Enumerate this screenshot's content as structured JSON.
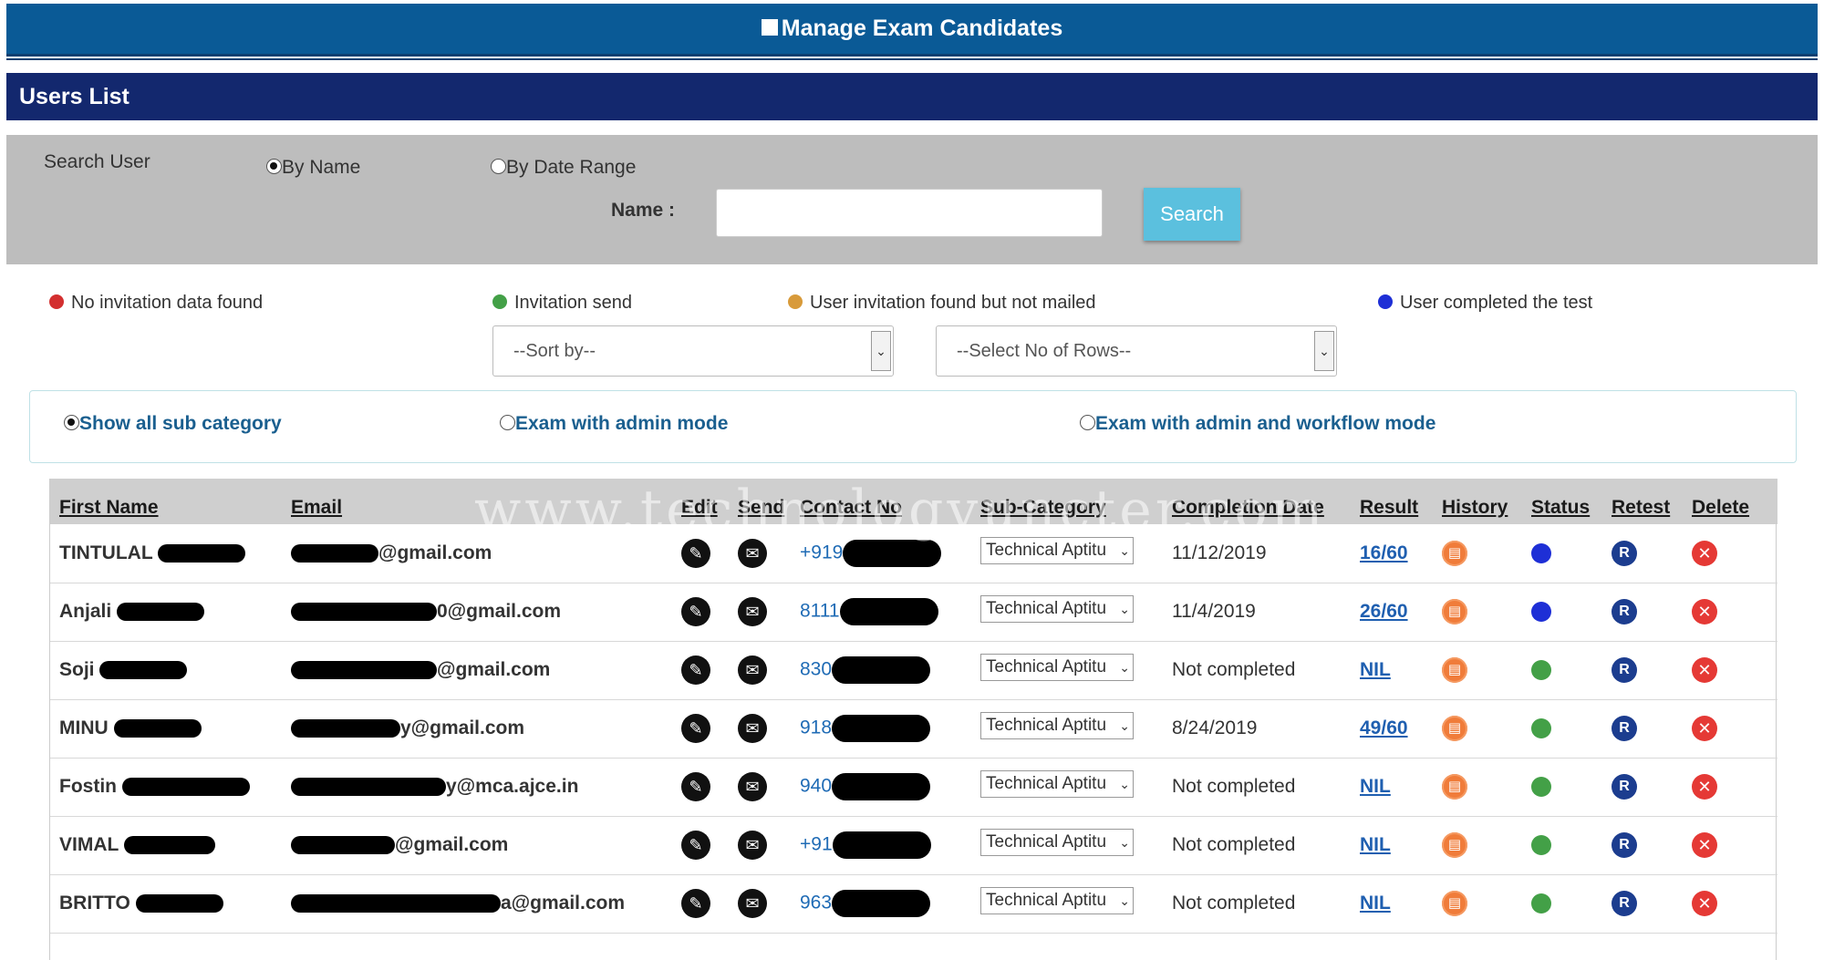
{
  "header": {
    "title": "Manage Exam Candidates"
  },
  "section": {
    "title": "Users List"
  },
  "search": {
    "label": "Search User",
    "by_name": "By Name",
    "by_date_range": "By Date Range",
    "name_label": "Name :",
    "name_value": "",
    "button": "Search"
  },
  "legend": {
    "items": [
      {
        "label": "No invitation data found",
        "color": "#d32f2f"
      },
      {
        "label": "Invitation send",
        "color": "#43a047"
      },
      {
        "label": "User invitation found but not mailed",
        "color": "#d89a3a"
      },
      {
        "label": "User completed the test",
        "color": "#1e2fd6"
      }
    ]
  },
  "filters": {
    "sort_by": "--Sort by--",
    "rows": "--Select No of Rows--"
  },
  "subcategory_options": {
    "show_all": "Show all sub category",
    "admin_mode": "Exam with admin mode",
    "admin_workflow": "Exam with admin and workflow mode"
  },
  "table": {
    "headers": {
      "first_name": "First Name",
      "email": "Email",
      "edit": "Edit",
      "send": "Send",
      "contact": "Contact No",
      "subcategory": "Sub-Category",
      "completion": "Completion Date",
      "result": "Result",
      "history": "History",
      "status": "Status",
      "retest": "Retest",
      "delete": "Delete"
    },
    "rows": [
      {
        "first": "TINTULAL",
        "email": "@gmail.com",
        "contact": "+919",
        "sub": "Technical Aptitu",
        "date": "11/12/2019",
        "result": "16/60",
        "status": "#1e2fd6"
      },
      {
        "first": "Anjali",
        "email": "0@gmail.com",
        "contact": "8111",
        "sub": "Technical Aptitu",
        "date": "11/4/2019",
        "result": "26/60",
        "status": "#1e2fd6"
      },
      {
        "first": "Soji",
        "email": "@gmail.com",
        "contact": "830",
        "sub": "Technical Aptitu",
        "date": "Not completed",
        "result": "NIL",
        "status": "#43a047"
      },
      {
        "first": "MINU",
        "email": "y@gmail.com",
        "contact": "918",
        "sub": "Technical Aptitu",
        "date": "8/24/2019",
        "result": "49/60",
        "status": "#43a047"
      },
      {
        "first": "Fostin",
        "email": "y@mca.ajce.in",
        "contact": "940",
        "sub": "Technical Aptitu",
        "date": "Not completed",
        "result": "NIL",
        "status": "#43a047"
      },
      {
        "first": "VIMAL",
        "email": "@gmail.com",
        "contact": "+91",
        "sub": "Technical Aptitu",
        "date": "Not completed",
        "result": "NIL",
        "status": "#43a047"
      },
      {
        "first": "BRITTO",
        "email": "a@gmail.com",
        "contact": "963",
        "sub": "Technical Aptitu",
        "date": "Not completed",
        "result": "NIL",
        "status": "#43a047"
      }
    ]
  },
  "watermark": "www.technologyuncter.com"
}
